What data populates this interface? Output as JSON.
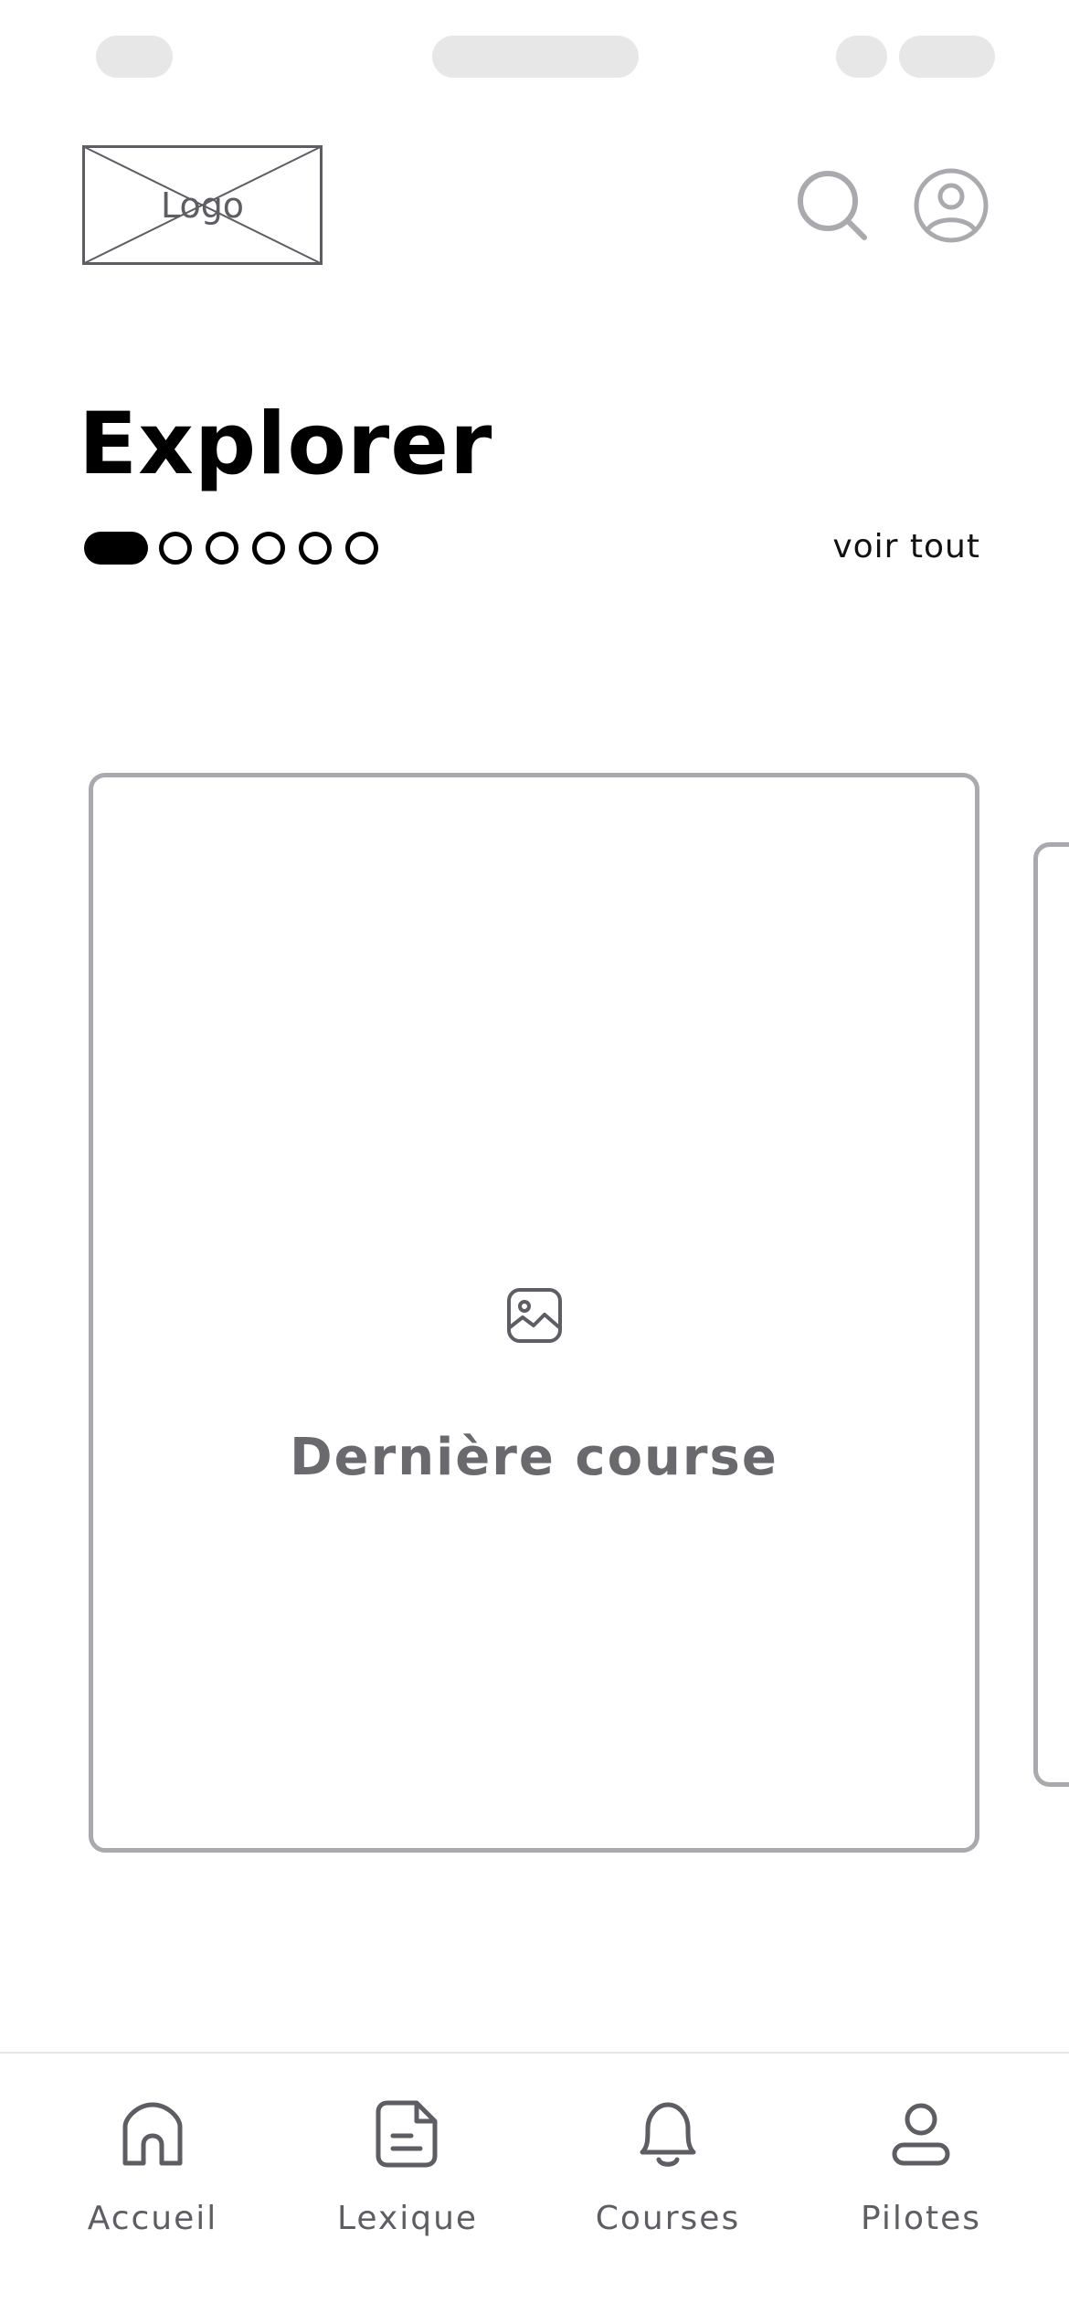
{
  "header": {
    "logo_label": "Logo",
    "search_icon": "search-icon",
    "profile_icon": "user-circle-icon"
  },
  "main": {
    "title": "Explorer",
    "pager": {
      "active_index": 0,
      "total": 6
    },
    "see_all_label": "voir tout",
    "card": {
      "icon": "image-icon",
      "label": "Dernière course"
    }
  },
  "bottom_nav": {
    "items": [
      {
        "label": "Accueil",
        "icon": "home-icon"
      },
      {
        "label": "Lexique",
        "icon": "document-icon"
      },
      {
        "label": "Courses",
        "icon": "bell-icon"
      },
      {
        "label": "Pilotes",
        "icon": "user-icon"
      }
    ]
  },
  "colors": {
    "text_primary": "#000000",
    "text_muted": "#6a6a6e",
    "icon_gray": "#5d5d63",
    "border_gray": "#a9a9ae",
    "placeholder_gray": "#e7e7e7"
  }
}
